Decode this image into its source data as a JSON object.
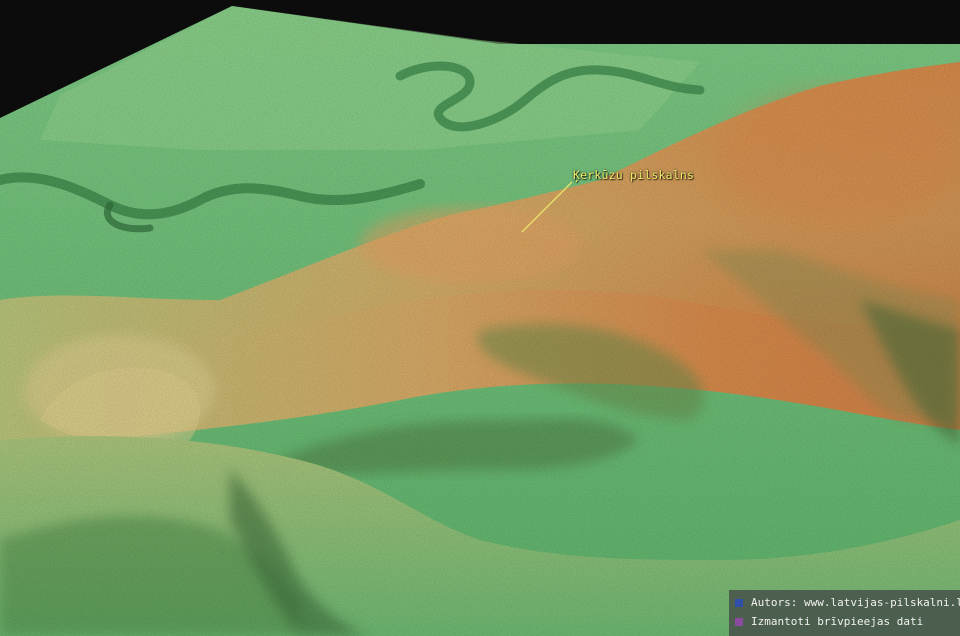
{
  "map": {
    "place_label": "Ķerkūzu pilskalns"
  },
  "legend": {
    "items": [
      {
        "text": "Autors: www.latvijas-pilskalni.lv",
        "color": "#2f4fa8"
      },
      {
        "text": "Izmantoti brīvpieejas dati",
        "color": "#8a4aa0"
      }
    ]
  },
  "colors": {
    "sky": "#0d0d0d",
    "low_terrain": "#6fbf7a",
    "mid_terrain": "#c9c27a",
    "high_terrain": "#d48a4a",
    "label": "#f4ee6a"
  }
}
